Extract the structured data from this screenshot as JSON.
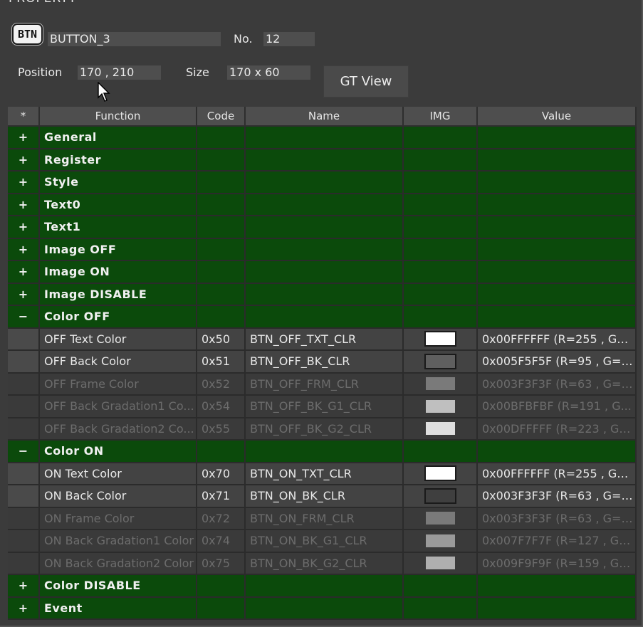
{
  "panel": {
    "title": "PROPERTY"
  },
  "object": {
    "type_badge": "BTN",
    "name": "BUTTON_3",
    "no_label": "No.",
    "no_value": "12",
    "position_label": "Position",
    "position_value": "170 , 210",
    "size_label": "Size",
    "size_value": "170 x 60",
    "gt_view_label": "GT View"
  },
  "table": {
    "headers": [
      "*",
      "Function",
      "Code",
      "Name",
      "IMG",
      "Value"
    ],
    "rows": [
      {
        "kind": "group",
        "toggle": "+",
        "function": "General"
      },
      {
        "kind": "group",
        "toggle": "+",
        "function": "Register"
      },
      {
        "kind": "group",
        "toggle": "+",
        "function": "Style"
      },
      {
        "kind": "group",
        "toggle": "+",
        "function": "Text0"
      },
      {
        "kind": "group",
        "toggle": "+",
        "function": "Text1"
      },
      {
        "kind": "group",
        "toggle": "+",
        "function": "Image OFF"
      },
      {
        "kind": "group",
        "toggle": "+",
        "function": "Image ON"
      },
      {
        "kind": "group",
        "toggle": "+",
        "function": "Image DISABLE"
      },
      {
        "kind": "group",
        "toggle": "−",
        "function": "Color OFF"
      },
      {
        "kind": "item",
        "enabled": true,
        "function": "OFF Text Color",
        "code": "0x50",
        "name": "BTN_OFF_TXT_CLR",
        "swatch": "#FFFFFF",
        "value": "0x00FFFFFF (R=255 , G=..."
      },
      {
        "kind": "item",
        "enabled": true,
        "function": "OFF Back Color",
        "code": "0x51",
        "name": "BTN_OFF_BK_CLR",
        "swatch": "#5F5F5F",
        "value": "0x005F5F5F (R=95 , G=9..."
      },
      {
        "kind": "item",
        "enabled": false,
        "function": "OFF Frame Color",
        "code": "0x52",
        "name": "BTN_OFF_FRM_CLR",
        "swatch": "#7A7A7A",
        "value": "0x003F3F3F (R=63 , G=6..."
      },
      {
        "kind": "item",
        "enabled": false,
        "function": "OFF Back Gradation1 Co...",
        "code": "0x54",
        "name": "BTN_OFF_BK_G1_CLR",
        "swatch": "#BFBFBF",
        "value": "0x00BFBFBF (R=191 , G..."
      },
      {
        "kind": "item",
        "enabled": false,
        "function": "OFF Back Gradation2 Co...",
        "code": "0x55",
        "name": "BTN_OFF_BK_G2_CLR",
        "swatch": "#DFDFDF",
        "value": "0x00DFFFFF (R=223 , G=..."
      },
      {
        "kind": "group",
        "toggle": "−",
        "function": "Color ON"
      },
      {
        "kind": "item",
        "enabled": true,
        "function": "ON Text Color",
        "code": "0x70",
        "name": "BTN_ON_TXT_CLR",
        "swatch": "#FFFFFF",
        "value": "0x00FFFFFF (R=255 , G=..."
      },
      {
        "kind": "item",
        "enabled": true,
        "function": "ON Back Color",
        "code": "0x71",
        "name": "BTN_ON_BK_CLR",
        "swatch": "#3F3F3F",
        "value": "0x003F3F3F (R=63 , G=6..."
      },
      {
        "kind": "item",
        "enabled": false,
        "function": "ON Frame Color",
        "code": "0x72",
        "name": "BTN_ON_FRM_CLR",
        "swatch": "#7A7A7A",
        "value": "0x003F3F3F (R=63 , G=6..."
      },
      {
        "kind": "item",
        "enabled": false,
        "function": "ON Back Gradation1 Color",
        "code": "0x74",
        "name": "BTN_ON_BK_G1_CLR",
        "swatch": "#9A9A9A",
        "value": "0x007F7F7F (R=127 , G=..."
      },
      {
        "kind": "item",
        "enabled": false,
        "function": "ON Back Gradation2 Color",
        "code": "0x75",
        "name": "BTN_ON_BK_G2_CLR",
        "swatch": "#AFAFAF",
        "value": "0x009F9F9F (R=159 , G=..."
      },
      {
        "kind": "group",
        "toggle": "+",
        "function": "Color DISABLE"
      },
      {
        "kind": "group",
        "toggle": "+",
        "function": "Event"
      }
    ]
  }
}
